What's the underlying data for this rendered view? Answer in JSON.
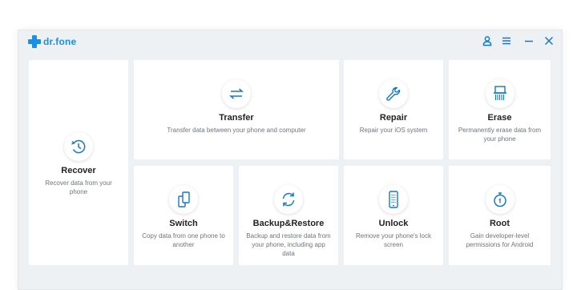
{
  "app": {
    "name": "dr.fone",
    "brand_color": "#1d8fe1",
    "icon_color": "#1877c8"
  },
  "titlebar": {
    "icons": [
      "user-icon",
      "menu-icon",
      "minimize-icon",
      "close-icon"
    ]
  },
  "modules": {
    "recover": {
      "title": "Recover",
      "desc": "Recover data from your phone",
      "icon": "clock-restore-icon"
    },
    "transfer": {
      "title": "Transfer",
      "desc": "Transfer data between your phone and computer",
      "icon": "transfer-arrows-icon"
    },
    "repair": {
      "title": "Repair",
      "desc": "Repair your iOS system",
      "icon": "wrench-icon"
    },
    "erase": {
      "title": "Erase",
      "desc": "Permanently erase data from your phone",
      "icon": "shredder-icon"
    },
    "switch": {
      "title": "Switch",
      "desc": "Copy data from one phone to another",
      "icon": "switch-phones-icon"
    },
    "backup": {
      "title": "Backup&Restore",
      "desc": "Backup and restore data from your phone, including app data",
      "icon": "sync-icon"
    },
    "unlock": {
      "title": "Unlock",
      "desc": "Remove your phone's lock screen",
      "icon": "phone-keypad-icon"
    },
    "root": {
      "title": "Root",
      "desc": "Gain developer-level permissions for Android",
      "icon": "root-stopwatch-icon"
    }
  }
}
